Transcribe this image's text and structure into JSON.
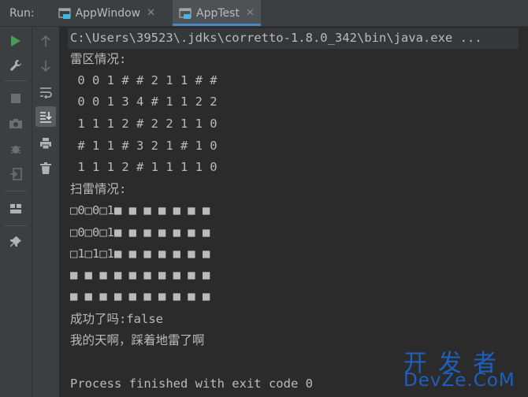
{
  "header": {
    "run_label": "Run:",
    "tabs": [
      {
        "label": "AppWindow",
        "active": false
      },
      {
        "label": "AppTest",
        "active": true
      }
    ]
  },
  "toolbar": {
    "primary": [
      "run-icon",
      "wrench-icon",
      "stop-icon",
      "camera-icon",
      "debug-bug-icon",
      "login-icon",
      "layout-icon",
      "pin-icon"
    ],
    "secondary": [
      "arrow-up-icon",
      "arrow-down-icon",
      "soft-wrap-icon",
      "scroll-to-end-icon",
      "print-icon",
      "trash-icon"
    ]
  },
  "console": {
    "lines": [
      "C:\\Users\\39523\\.jdks\\corretto-1.8.0_342\\bin\\java.exe ...",
      "雷区情况:",
      " 0 0 1 # # 2 1 1 # #",
      " 0 0 1 3 4 # 1 1 2 2",
      " 1 1 1 2 # 2 2 1 1 0",
      " # 1 1 # 3 2 1 # 1 0",
      " 1 1 1 2 # 1 1 1 1 0",
      "扫雷情况:",
      "□0□0□1■ ■ ■ ■ ■ ■ ■",
      "□0□0□1■ ■ ■ ■ ■ ■ ■",
      "□1□1□1■ ■ ■ ■ ■ ■ ■",
      "■ ■ ■ ■ ■ ■ ■ ■ ■ ■",
      "■ ■ ■ ■ ■ ■ ■ ■ ■ ■",
      "成功了吗:false",
      "我的天啊，踩着地雷了啊",
      "",
      "Process finished with exit code 0"
    ]
  },
  "watermark": {
    "cn": "开发者",
    "en": "DevZe.CoM"
  },
  "colors": {
    "run_green": "#499c54",
    "accent_blue": "#4a88c7",
    "watermark": "#1f5fbf"
  }
}
